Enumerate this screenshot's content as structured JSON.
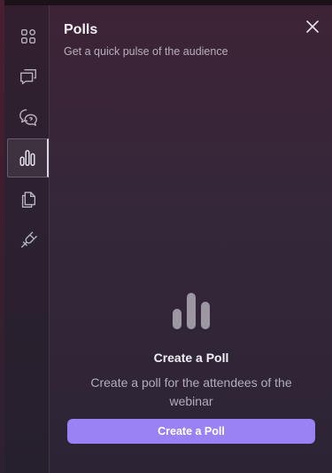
{
  "panel": {
    "title": "Polls",
    "subtitle": "Get a quick pulse of the audience"
  },
  "sidebar": {
    "items": [
      {
        "icon": "apps-grid-icon",
        "label": "Apps"
      },
      {
        "icon": "chat-icon",
        "label": "Chat"
      },
      {
        "icon": "qa-icon",
        "label": "Q&A"
      },
      {
        "icon": "polls-icon",
        "label": "Polls",
        "active": true
      },
      {
        "icon": "files-icon",
        "label": "Files"
      },
      {
        "icon": "integrations-plug-icon",
        "label": "Integrations"
      }
    ]
  },
  "empty_state": {
    "icon": "poll-bars-icon",
    "title": "Create a Poll",
    "description": "Create a poll for the attendees of the webinar",
    "button_label": "Create a Poll"
  },
  "colors": {
    "accent": "#9a82f5",
    "panel_bg": "#35273a",
    "title_text": "#f3f0f5",
    "muted_text": "#b5adba"
  }
}
